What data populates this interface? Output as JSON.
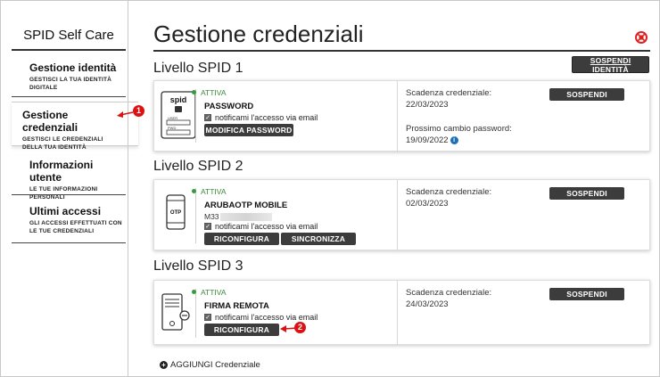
{
  "sidebar": {
    "brand": "SPID Self Care",
    "items": [
      {
        "label": "Gestione identità",
        "sub": "GESTISCI LA TUA IDENTITÀ DIGITALE"
      },
      {
        "label": "Gestione credenziali",
        "sub": "GESTISCI LE CREDENZIALI DELLA TUA IDENTITÀ"
      },
      {
        "label": "Informazioni utente",
        "sub": "LE TUE INFORMAZIONI PERSONALI"
      },
      {
        "label": "Ultimi accessi",
        "sub": "GLI ACCESSI EFFETTUATI CON LE TUE CREDENZIALI"
      }
    ],
    "active_index": 1
  },
  "main": {
    "title": "Gestione credenziali",
    "suspend_identity_label": "SOSPENDI IDENTITÀ",
    "add_credential_label": "AGGIUNGI Credenziale"
  },
  "levels": [
    {
      "title": "Livello SPID 1",
      "credential": {
        "status": "ATTIVA",
        "name": "PASSWORD",
        "notify": "notificami l'accesso via email",
        "buttons": [
          "MODIFICA PASSWORD"
        ],
        "expiry_label": "Scadenza credenziale:",
        "expiry_date": "22/03/2023",
        "change_label": "Prossimo cambio password:",
        "change_date": "19/09/2022",
        "suspend_label": "SOSPENDI",
        "icon": "spid-password-icon"
      }
    },
    {
      "title": "Livello SPID 2",
      "credential": {
        "status": "ATTIVA",
        "name": "ARUBAOTP MOBILE",
        "id_prefix": "M33",
        "notify": "notificami l'accesso via email",
        "buttons": [
          "RICONFIGURA",
          "SINCRONIZZA"
        ],
        "expiry_label": "Scadenza credenziale:",
        "expiry_date": "02/03/2023",
        "suspend_label": "SOSPENDI",
        "icon": "otp-phone-icon"
      }
    },
    {
      "title": "Livello SPID 3",
      "credential": {
        "status": "ATTIVA",
        "name": "FIRMA REMOTA",
        "notify": "notificami l'accesso via email",
        "buttons": [
          "RICONFIGURA"
        ],
        "expiry_label": "Scadenza credenziale:",
        "expiry_date": "24/03/2023",
        "suspend_label": "SOSPENDI",
        "icon": "remote-signature-icon"
      }
    }
  ],
  "callouts": [
    "1",
    "2"
  ],
  "colors": {
    "accent_dark": "#3c3c3c",
    "status_green": "#3a8a3a",
    "callout_red": "#dd1111",
    "info_blue": "#1e6fb8"
  }
}
